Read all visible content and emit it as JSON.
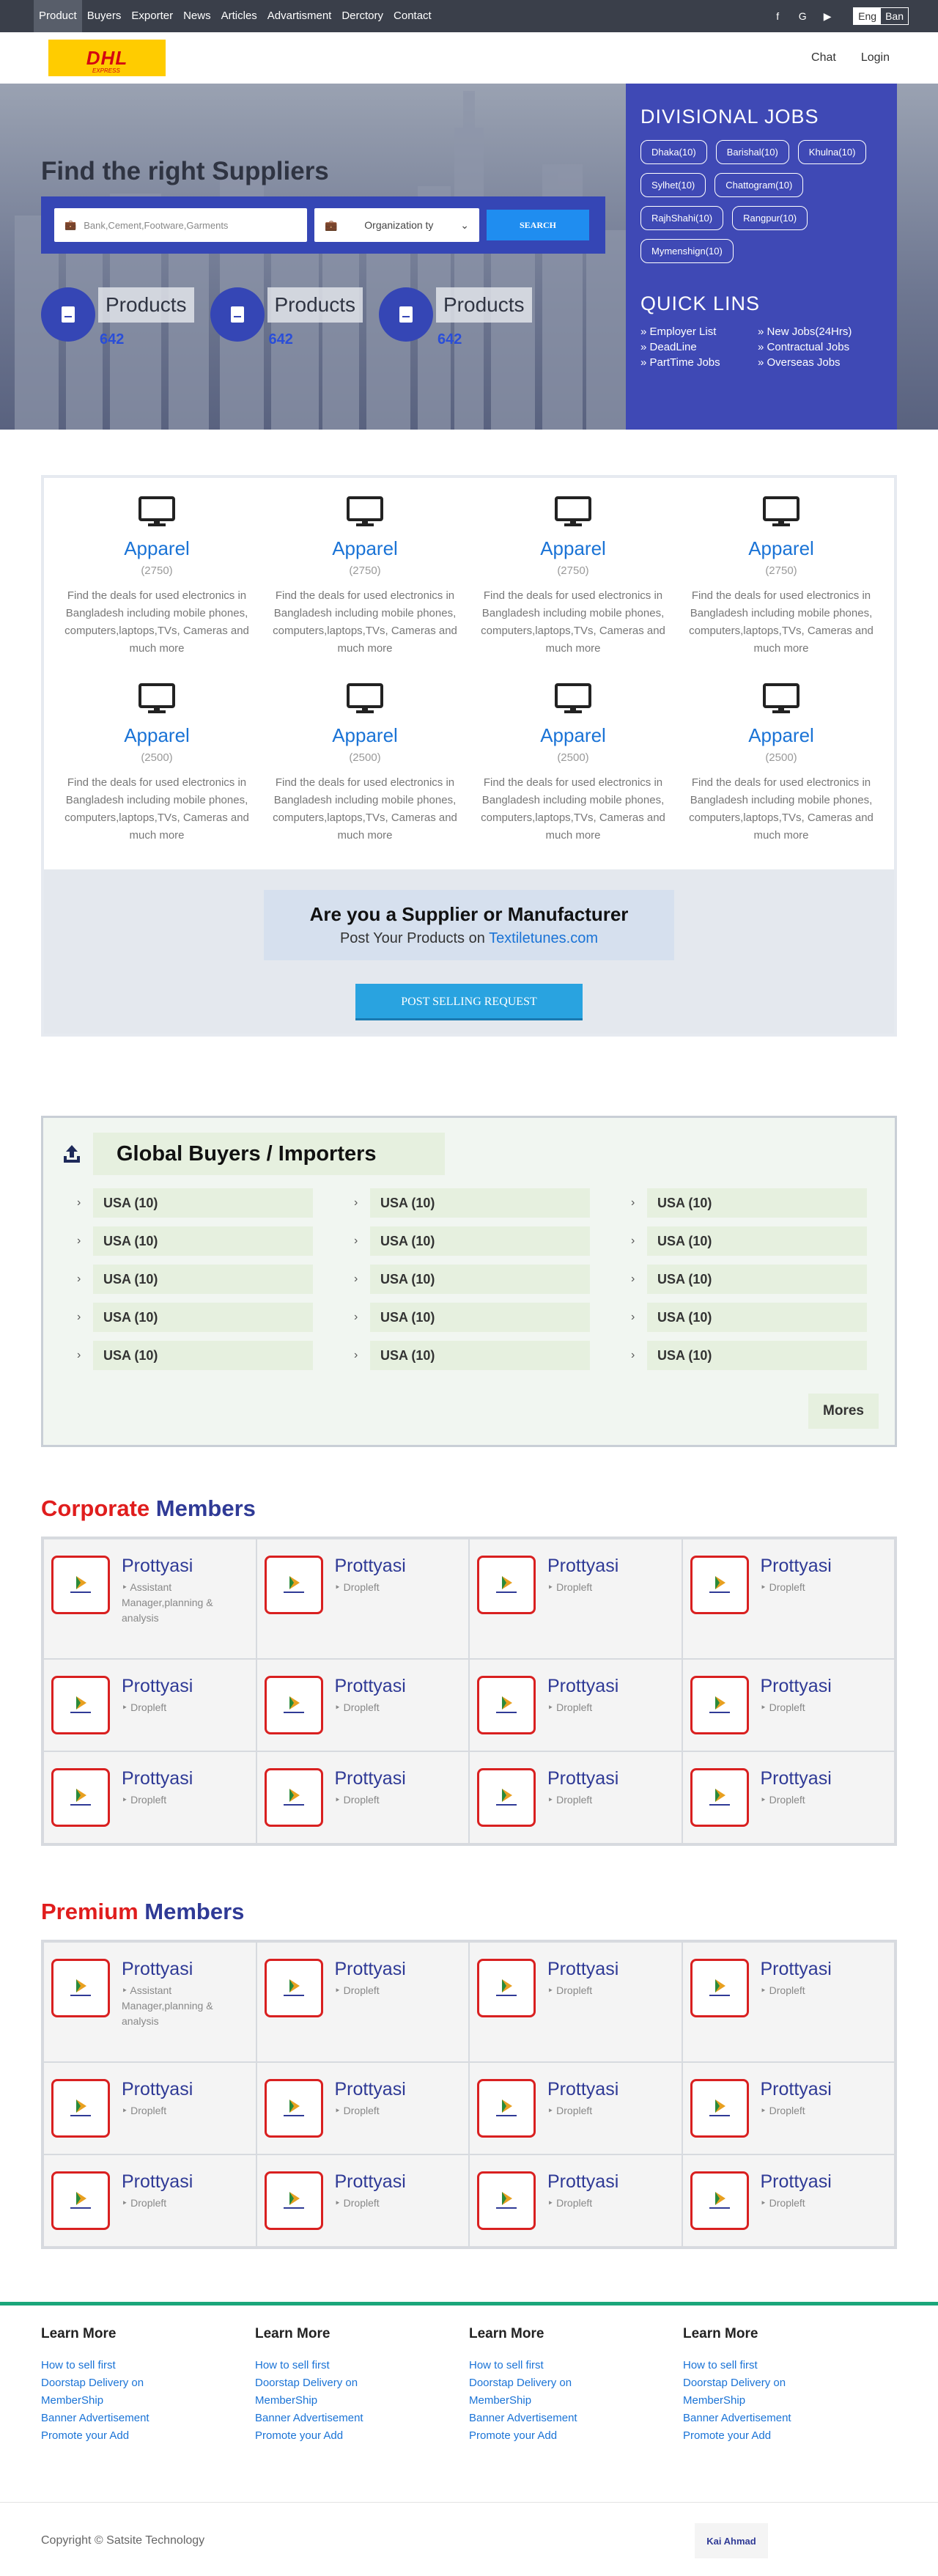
{
  "topnav": [
    "Product",
    "Buyers",
    "Exporter",
    "News",
    "Articles",
    "Advartisment",
    "Derctory",
    "Contact"
  ],
  "social_icons": [
    "facebook-icon",
    "google-icon",
    "youtube-icon"
  ],
  "lang": [
    "Eng",
    "Ban"
  ],
  "header": {
    "chat": "Chat",
    "login": "Login"
  },
  "hero": {
    "title": "Find the right Suppliers",
    "search_placeholder": "Bank,Cement,Footware,Garments",
    "select_value": "Organization ty",
    "search_btn": "SEARCH",
    "stats": [
      {
        "label": "Products",
        "num": "642"
      },
      {
        "label": "Products",
        "num": "642"
      },
      {
        "label": "Products",
        "num": "642"
      }
    ]
  },
  "divisional": {
    "title": "DIVISIONAL JOBS",
    "chips": [
      "Dhaka(10)",
      "Barishal(10)",
      "Khulna(10)",
      "Sylhet(10)",
      "Chattogram(10)",
      "RajhShahi(10)",
      "Rangpur(10)",
      "Mymenshign(10)"
    ],
    "quick_title": "QUICK LINS",
    "quick": [
      "Employer List",
      "New Jobs(24Hrs)",
      "DeadLine",
      "Contractual Jobs",
      "PartTime Jobs",
      "Overseas Jobs"
    ]
  },
  "categories": [
    {
      "name": "Apparel",
      "count": "(2750)",
      "desc": "Find the deals for used electronics in Bangladesh including mobile phones, computers,laptops,TVs, Cameras and much more"
    },
    {
      "name": "Apparel",
      "count": "(2750)",
      "desc": "Find the deals for used electronics in Bangladesh including mobile phones, computers,laptops,TVs, Cameras and much more"
    },
    {
      "name": "Apparel",
      "count": "(2750)",
      "desc": "Find the deals for used electronics in Bangladesh including mobile phones, computers,laptops,TVs, Cameras and much more"
    },
    {
      "name": "Apparel",
      "count": "(2750)",
      "desc": "Find the deals for used electronics in Bangladesh including mobile phones, computers,laptops,TVs, Cameras and much more"
    },
    {
      "name": "Apparel",
      "count": "(2500)",
      "desc": "Find the deals for used electronics in Bangladesh including mobile phones, computers,laptops,TVs, Cameras and much more"
    },
    {
      "name": "Apparel",
      "count": "(2500)",
      "desc": "Find the deals for used electronics in Bangladesh including mobile phones, computers,laptops,TVs, Cameras and much more"
    },
    {
      "name": "Apparel",
      "count": "(2500)",
      "desc": "Find the deals for used electronics in Bangladesh including mobile phones, computers,laptops,TVs, Cameras and much more"
    },
    {
      "name": "Apparel",
      "count": "(2500)",
      "desc": "Find the deals for used electronics in Bangladesh including mobile phones, computers,laptops,TVs, Cameras and much more"
    }
  ],
  "supplier": {
    "title": "Are you a Supplier or Manufacturer",
    "sub": "Post Your Products on ",
    "site": "Textiletunes.com",
    "btn": "POST SELLING REQUEST"
  },
  "buyers": {
    "title": "Global Buyers / Importers",
    "item": "USA  (10)",
    "more": "Mores"
  },
  "corporate": {
    "w1": "Corporate",
    "w2": "Members"
  },
  "premium": {
    "w1": "Premium",
    "w2": "Members"
  },
  "member": {
    "name": "Prottyasi",
    "role_long": "Assistant Manager,planning & analysis",
    "role": "Dropleft"
  },
  "footer": {
    "title": "Learn More",
    "links": [
      "How to sell first",
      "Doorstap Delivery on MemberShip",
      "Banner Advertisement",
      "Promote your Add"
    ],
    "copy": "Copyright © Satsite Technology",
    "logo_text": "Kai Ahmad"
  }
}
